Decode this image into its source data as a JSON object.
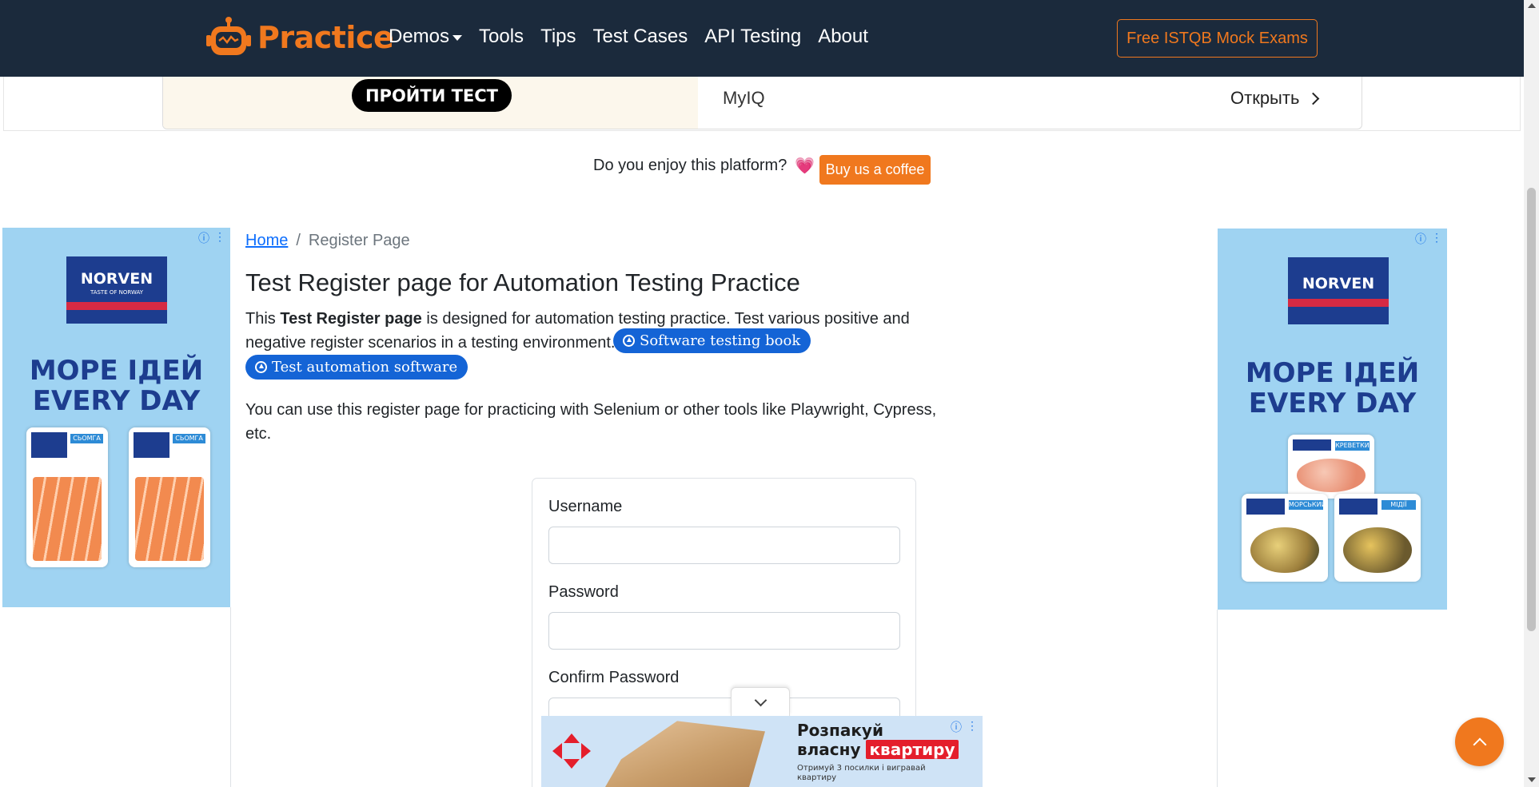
{
  "navbar": {
    "brand": "Practice",
    "links": [
      "Demos",
      "Tools",
      "Tips",
      "Test Cases",
      "API Testing",
      "About"
    ],
    "cta": "Free ISTQB Mock Exams"
  },
  "top_ad": {
    "cta": "ПРОЙТИ ТЕСТ",
    "name": "MyIQ",
    "open": "Открыть"
  },
  "enjoy": {
    "text": "Do you enjoy this platform?",
    "heart": "💗",
    "button": "Buy us a coffee"
  },
  "left_ad": {
    "brand": "NORVEN",
    "brand_sub": "TASTE OF NORWAY",
    "headline_1": "МОРЕ ІДЕЙ",
    "headline_2": "EVERY DAY",
    "pack_label": "СЬОМГА"
  },
  "right_ad": {
    "brand": "NORVEN",
    "headline_1": "МОРЕ ІДЕЙ",
    "headline_2": "EVERY DAY",
    "pack_1": "КРЕВЕТКИ",
    "pack_2": "МОРСЬКИЙ КОКТЕЙЛЬ",
    "pack_3": "МІДІЇ"
  },
  "breadcrumb": {
    "home": "Home",
    "separator": "/",
    "current": "Register Page"
  },
  "main": {
    "title": "Test Register page for Automation Testing Practice",
    "intro_prefix": "This ",
    "intro_bold": "Test Register page",
    "intro_suffix": " is designed for automation testing practice. Test various positive and negative register scenarios in a testing environment.",
    "pill_1": "Software testing book",
    "pill_2": "Test automation software",
    "usage": "You can use this register page for practicing with Selenium or other tools like Playwright, Cypress, etc."
  },
  "form": {
    "username_label": "Username",
    "username_value": "",
    "password_label": "Password",
    "password_value": "",
    "confirm_label": "Confirm Password",
    "confirm_value": ""
  },
  "bottom_ad": {
    "line_1": "Розпакуй",
    "line_2a": "власну",
    "line_2b": "квартиру",
    "line_3": "Отримуй 3 посилки і вигравай квартиру"
  },
  "colors": {
    "navbar_bg": "#1b2a3c",
    "accent": "#f0781e",
    "link": "#0d6efd",
    "pill": "#1464d6"
  },
  "icons": [
    "robot-logo-icon",
    "caret-down-icon",
    "chevron-right-icon",
    "heart-icon",
    "ad-info-icon",
    "ad-menu-icon",
    "chevron-down-icon",
    "chevron-up-icon",
    "nova-poshta-logo-icon"
  ]
}
